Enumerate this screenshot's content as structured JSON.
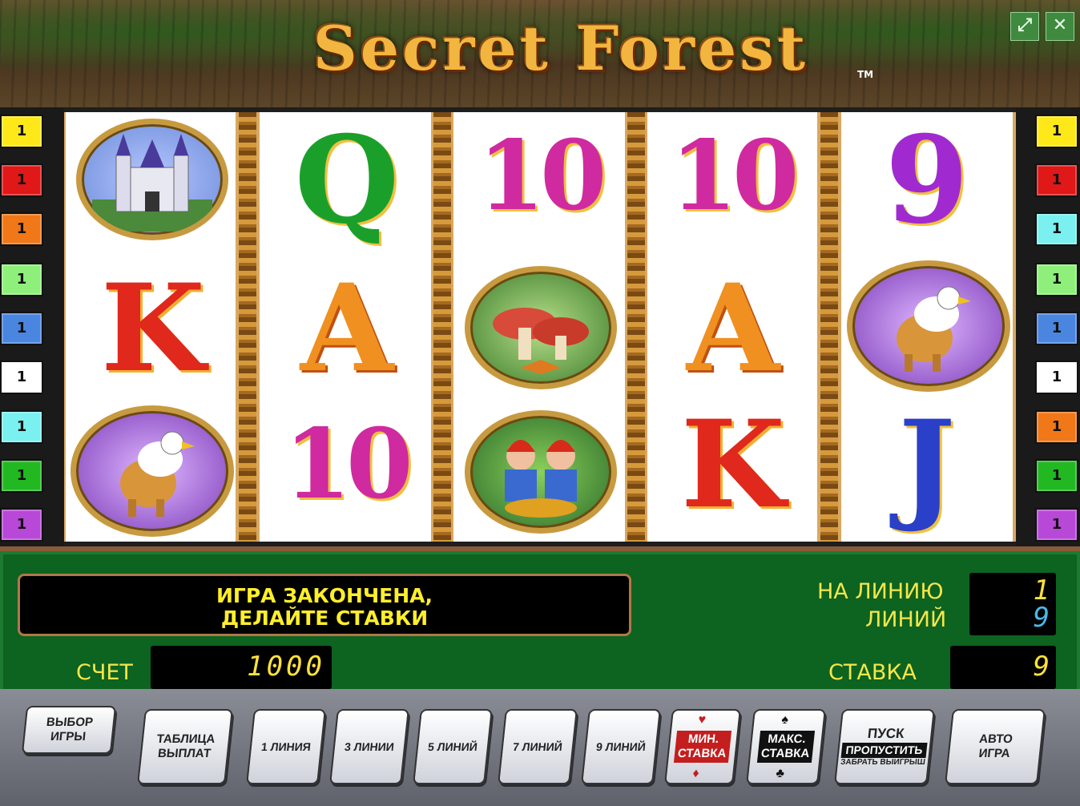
{
  "header": {
    "title": "Secret Forest",
    "tm": "TM",
    "fullscreen_icon": "expand-icon",
    "close_icon": "close-icon"
  },
  "line_badges_left": [
    {
      "label": "1",
      "color": "#ffe81a"
    },
    {
      "label": "1",
      "color": "#e01818"
    },
    {
      "label": "1",
      "color": "#f07818"
    },
    {
      "label": "1",
      "color": "#8ef07a"
    },
    {
      "label": "1",
      "color": "#4a86e0"
    },
    {
      "label": "1",
      "color": "#ffffff"
    },
    {
      "label": "1",
      "color": "#7af0f0"
    },
    {
      "label": "1",
      "color": "#22b822"
    },
    {
      "label": "1",
      "color": "#b848d8"
    }
  ],
  "line_badges_right": [
    {
      "label": "1",
      "color": "#ffe81a"
    },
    {
      "label": "1",
      "color": "#e01818"
    },
    {
      "label": "1",
      "color": "#7af0f0"
    },
    {
      "label": "1",
      "color": "#8ef07a"
    },
    {
      "label": "1",
      "color": "#4a86e0"
    },
    {
      "label": "1",
      "color": "#ffffff"
    },
    {
      "label": "1",
      "color": "#f07818"
    },
    {
      "label": "1",
      "color": "#22b822"
    },
    {
      "label": "1",
      "color": "#b848d8"
    }
  ],
  "reels": [
    [
      "castle",
      "K",
      "griffin"
    ],
    [
      "Q",
      "A",
      "10"
    ],
    [
      "10",
      "mushrooms",
      "dwarves"
    ],
    [
      "10",
      "A",
      "K"
    ],
    [
      "9",
      "griffin",
      "J"
    ]
  ],
  "message": {
    "line1": "ИГРА ЗАКОНЧЕНА,",
    "line2": "ДЕЛАЙТЕ СТАВКИ"
  },
  "labels": {
    "per_line": "НА ЛИНИЮ",
    "lines": "ЛИНИЙ",
    "credit": "СЧЕТ",
    "bet": "СТАВКА"
  },
  "values": {
    "per_line": "1",
    "lines": "9",
    "credit": "1000",
    "bet": "9"
  },
  "buttons": {
    "choose_game": [
      "ВЫБОР",
      "ИГРЫ"
    ],
    "paytable": [
      "ТАБЛИЦА",
      "ВЫПЛАТ"
    ],
    "line1": "1 ЛИНИЯ",
    "line3": "3 ЛИНИИ",
    "line5": "5 ЛИНИЙ",
    "line7": "7 ЛИНИЙ",
    "line9": "9 ЛИНИЙ",
    "min_bet": [
      "МИН.",
      "СТАВКА"
    ],
    "max_bet": [
      "МАКС.",
      "СТАВКА"
    ],
    "start": [
      "ПУСК",
      "ПРОПУСТИТЬ",
      "ЗАБРАТЬ ВЫИГРЫШ"
    ],
    "auto": [
      "АВТО",
      "ИГРА"
    ]
  },
  "colors": {
    "panel_green": "#0d6320",
    "text_yellow": "#f5e64a",
    "lines_value": "#4ab8e8"
  }
}
